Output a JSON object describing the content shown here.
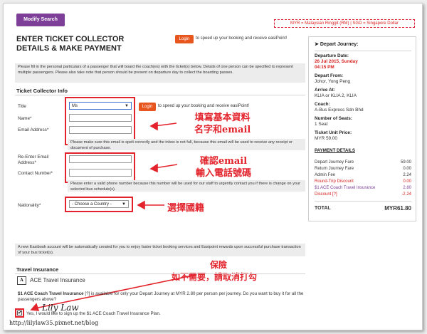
{
  "header": {
    "modify_search": "Modify Search",
    "currency_note": "MYR = Malaysian Ringgit (RM) | SGD = Singapore Dollar",
    "title_line1": "ENTER TICKET COLLECTOR",
    "title_line2": "DETAILS & MAKE PAYMENT",
    "login_label": "Login",
    "login_text": "to speed up your booking and receive easiPoint!"
  },
  "intro": "Please fill in the personal particulars of a passenger that will board the coach(es) with the ticket(s) below. Details of one person can be specified to represent multiple passengers. Please also take note that person should be present on departure day to collect the boarding passes.",
  "collector": {
    "section_title": "Ticket Collector Info",
    "title_label": "Title",
    "title_value": "Ms",
    "login_label": "Login",
    "login_text": "to speed up your booking and receive easiPoint!",
    "name_label": "Name*",
    "email_label": "Email Address*",
    "email_note": "Please make sure this email is spelt correctly and the inbox is not full, because this email will be used to receive any receipt or document of purchase.",
    "reemail_label": "Re-Enter Email Address*",
    "contact_label": "Contact Number*",
    "contact_note": "Please enter a valid phone number because this number will be used for our staff to urgently contact you if there is change on your selected bus schedule(s).",
    "nationality_label": "Nationality*",
    "nationality_value": "- Choose a Country -"
  },
  "annotations": {
    "fill_basic_line1": "填寫基本資料",
    "fill_basic_line2": "名字和email",
    "confirm_line1": "確認email",
    "confirm_line2": "輸入電話號碼",
    "nationality": "選擇國籍",
    "insurance_line1": "保險",
    "insurance_line2": "如不需要，請取消打勾"
  },
  "account_note": "A new Easibook account will be automatically created for you to enjoy faster ticket booking services and Easipoint rewards upon successful purchase transaction of your bus ticket(s).",
  "insurance": {
    "section_title": "Travel Insurance",
    "brand": "ACE Travel Insurance",
    "desc_bold": "$1 ACE Coach Travel Insurance",
    "desc_rest": " [?] is available for only your Depart Journey at MYR 2.80 per person per journey. Do you want to buy it for all the passengers above?",
    "checkbox_label": "Yes, I would like to sign up the $1 ACE Coach Travel Insurance Plan.",
    "checked": true
  },
  "watermark": {
    "signature": "Lily Law",
    "url": "http://lilylaw35.pixnet.net/blog"
  },
  "journey": {
    "title": "Depart Journey:",
    "date_label": "Departure Date:",
    "date_value": "26 Jul 2015, Sunday",
    "time_value": "04:15 PM",
    "from_label": "Depart From:",
    "from_value": "Johor, Yong Peng",
    "arrive_label": "Arrive At:",
    "arrive_value": "KLIA or KLIA 2, KLIA",
    "coach_label": "Coach:",
    "coach_value": "A-Bus Express Sdn Bhd",
    "seats_label": "Number of Seats:",
    "seats_value": "1 Seat",
    "price_label": "Ticket Unit Price:",
    "price_value": "MYR 59.00"
  },
  "payment": {
    "title": "PAYMENT DETAILS",
    "rows": [
      {
        "label": "Depart Journey Fare",
        "value": "59.00",
        "style": "normal"
      },
      {
        "label": "Return Journey Fare",
        "value": "0.00",
        "style": "normal"
      },
      {
        "label": "Admin Fee",
        "value": "2.24",
        "style": "normal"
      },
      {
        "label": "Round-Trip Discount",
        "value": "0.00",
        "style": "red"
      },
      {
        "label": "$1 ACE Coach Travel Insurance",
        "value": "2.80",
        "style": "purple"
      },
      {
        "label": "Discount [?]",
        "value": "-2.24",
        "style": "red"
      }
    ],
    "total_label": "TOTAL",
    "total_value": "MYR61.80"
  }
}
